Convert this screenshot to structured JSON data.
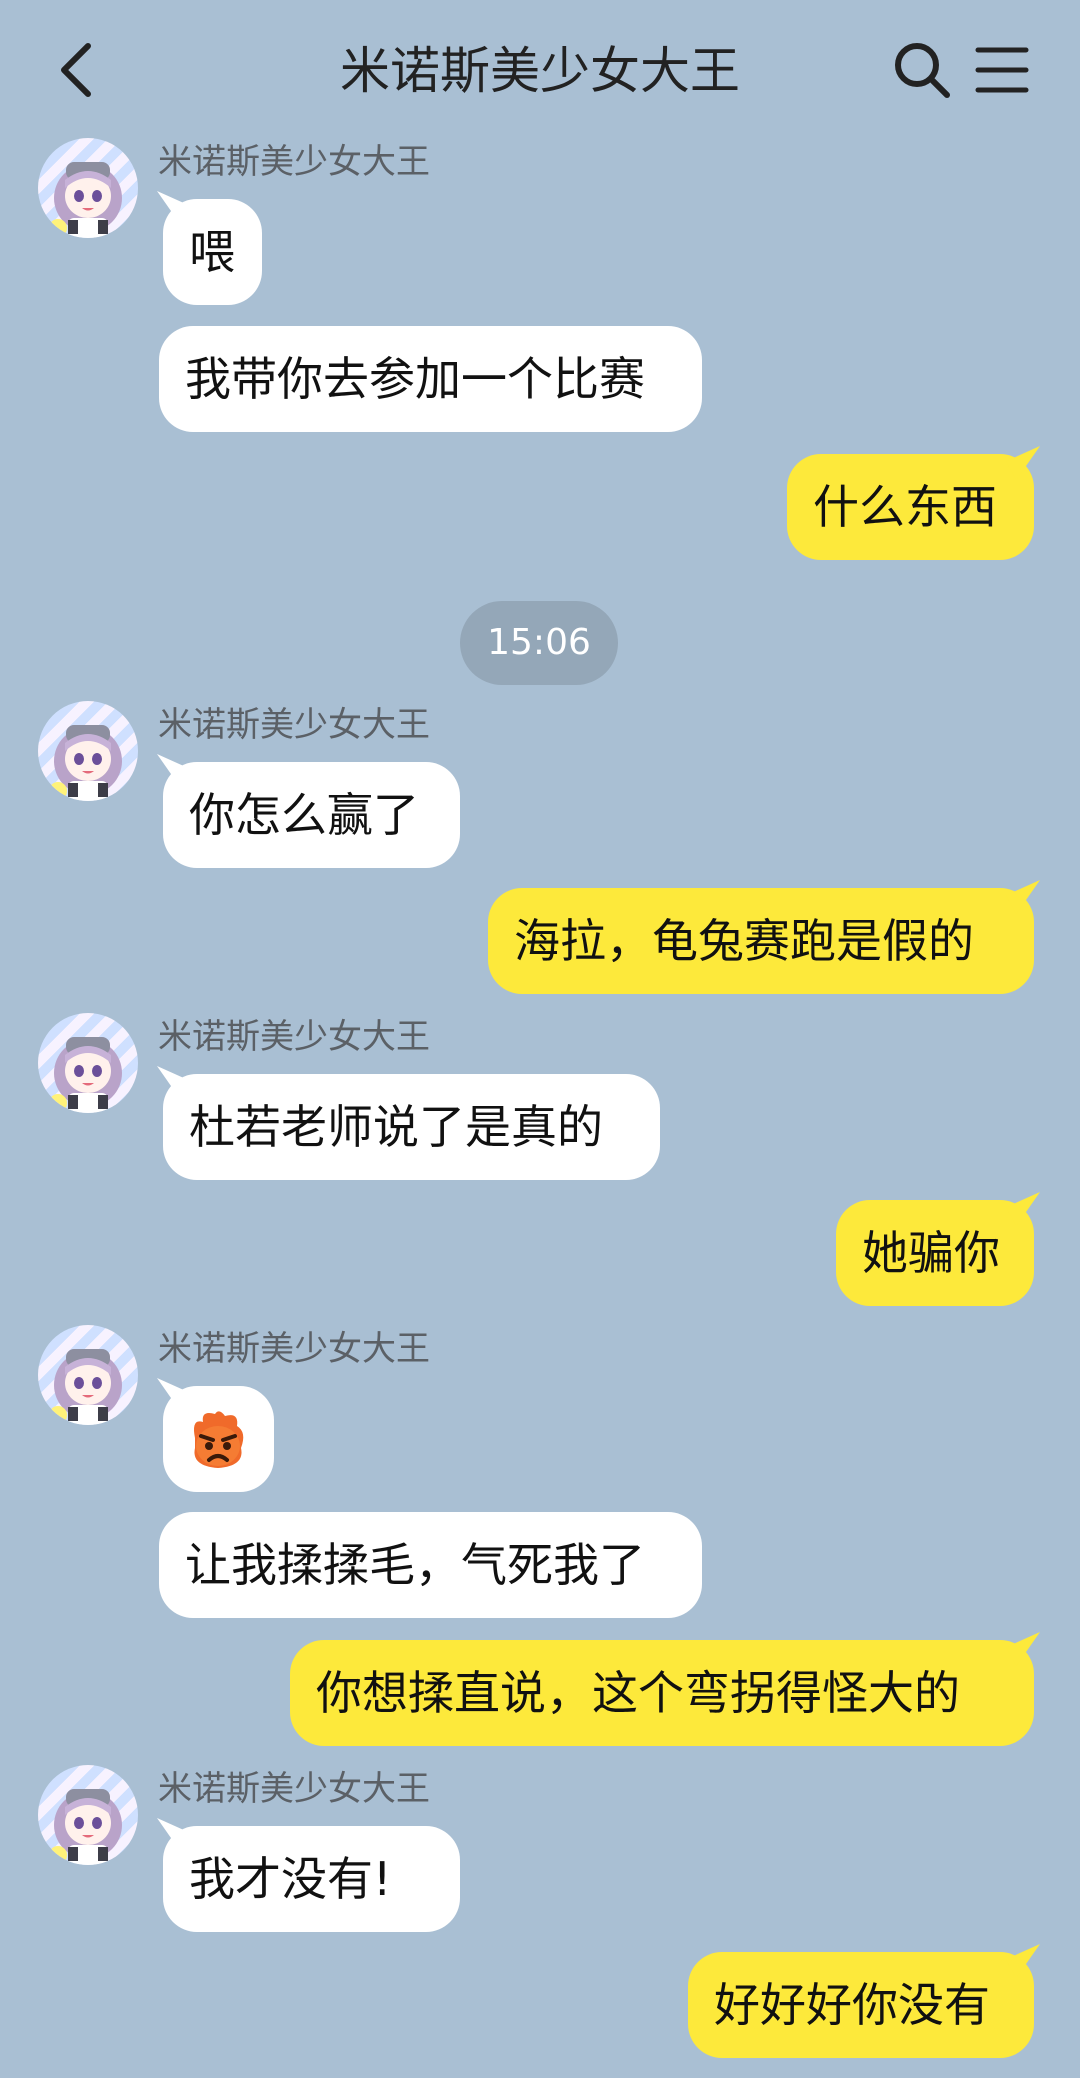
{
  "header": {
    "title": "米诺斯美少女大王",
    "back_icon": "chevron-left-icon",
    "search_icon": "search-icon",
    "menu_icon": "menu-icon"
  },
  "colors": {
    "background": "#a9bfd3",
    "own_bubble": "#fde93b",
    "other_bubble": "#ffffff",
    "timestamp_pill": "#94a7b8"
  },
  "timestamp": "15:06",
  "messages": [
    {
      "side": "left",
      "sender": "米诺斯美少女大王",
      "text": "喂"
    },
    {
      "side": "left",
      "text": "我带你去参加一个比赛"
    },
    {
      "side": "right",
      "text": "什么东西"
    },
    {
      "side": "left",
      "sender": "米诺斯美少女大王",
      "text": "你怎么赢了"
    },
    {
      "side": "right",
      "text": "海拉，龟兔赛跑是假的"
    },
    {
      "side": "left",
      "sender": "米诺斯美少女大王",
      "text": "杜若老师说了是真的"
    },
    {
      "side": "right",
      "text": "她骗你"
    },
    {
      "side": "left",
      "sender": "米诺斯美少女大王",
      "emoji": "angry-face-emoji"
    },
    {
      "side": "left",
      "text": "让我揉揉毛，气死我了"
    },
    {
      "side": "right",
      "text": "你想揉直说，这个弯拐得怪大的"
    },
    {
      "side": "left",
      "sender": "米诺斯美少女大王",
      "text": "我才没有!"
    },
    {
      "side": "right",
      "text": "好好好你没有"
    }
  ]
}
